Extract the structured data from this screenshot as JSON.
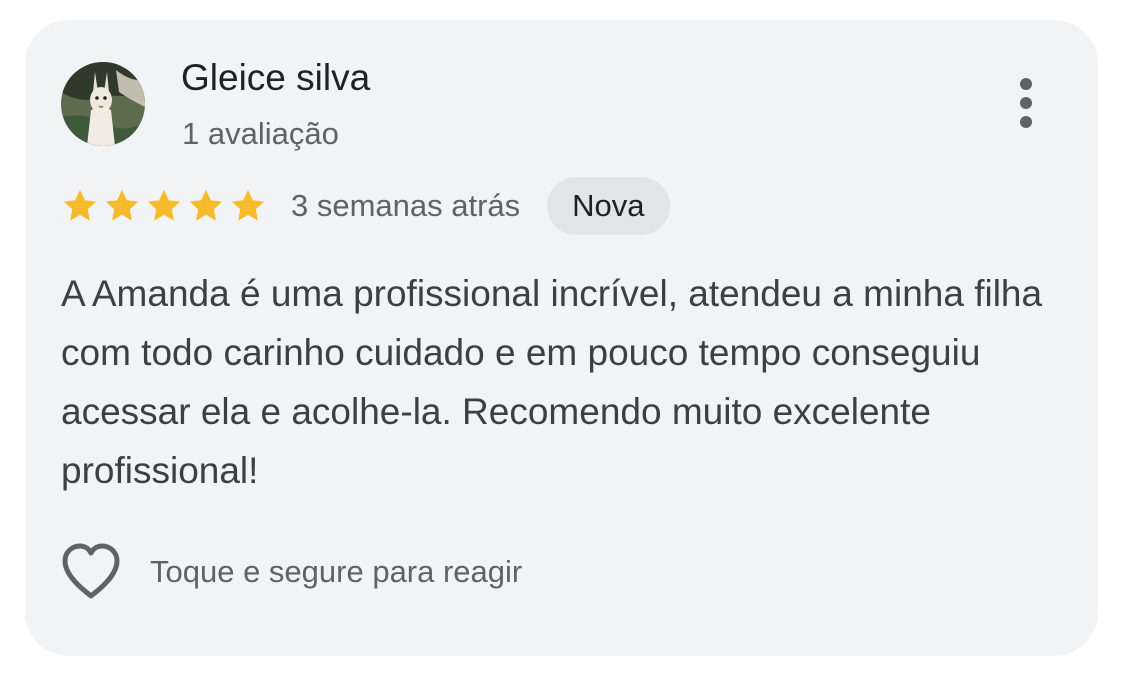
{
  "review": {
    "author_name": "Gleice silva",
    "author_review_count": "1 avaliação",
    "rating": 5,
    "rating_max": 5,
    "time_ago": "3 semanas atrás",
    "badge": "Nova",
    "text": "A Amanda é uma profissional incrível, atendeu a minha filha com todo carinho cuidado e em pouco tempo conseguiu acessar ela e acolhe-la. Recomendo muito excelente profissional!",
    "react_hint": "Toque e segure para reagir"
  },
  "icons": {
    "more": "more-vertical-icon",
    "star": "star-icon",
    "heart": "heart-outline-icon",
    "avatar": "user-avatar-photo"
  },
  "colors": {
    "card_background": "#f2f3f5",
    "star": "#f6bb2d",
    "badge_background": "#e3e4e6",
    "text_primary": "#202124",
    "text_secondary": "#5f6368",
    "text_body": "#3c4043"
  }
}
